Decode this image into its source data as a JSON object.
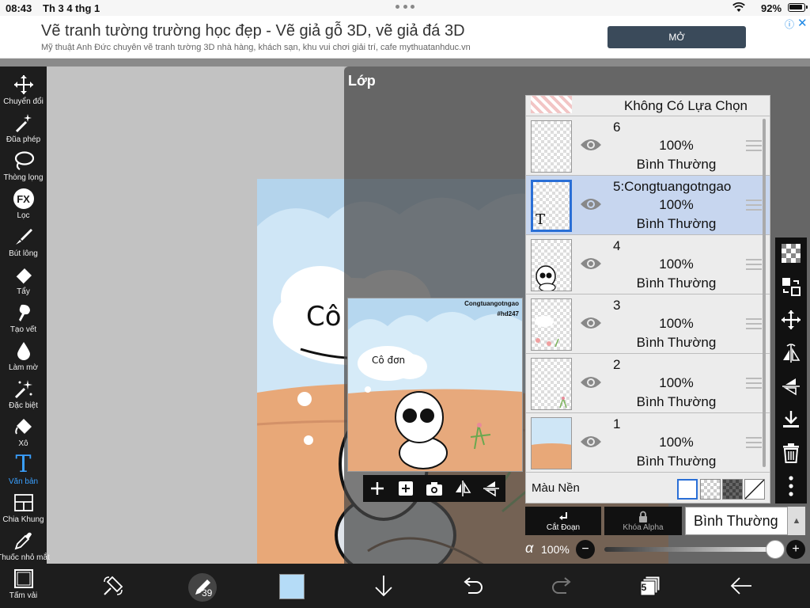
{
  "status_bar": {
    "time": "08:43",
    "date": "Th 3 4 thg 1",
    "battery": "92%"
  },
  "ad": {
    "title": "Vẽ tranh tường trường học đẹp - Vẽ giả gỗ 3D, vẽ giả đá 3D",
    "subtitle": "Mỹ thuật Anh Đức chuyên vẽ tranh tường 3D nhà hàng, khách sạn, khu vui chơi giải trí, cafe mythuatanhduc.vn",
    "button": "MỞ",
    "info_icon": "ⓘ",
    "close_icon": "✕"
  },
  "tools": [
    {
      "label": "Chuyển đổi",
      "icon": "move-icon"
    },
    {
      "label": "Đũa phép",
      "icon": "magic-wand-icon"
    },
    {
      "label": "Thòng lọng",
      "icon": "lasso-icon"
    },
    {
      "label": "Lọc",
      "icon": "fx-filter-icon",
      "glyph": "FX"
    },
    {
      "label": "Bút lông",
      "icon": "brush-icon"
    },
    {
      "label": "Tẩy",
      "icon": "eraser-icon"
    },
    {
      "label": "Tạo vết",
      "icon": "smudge-icon"
    },
    {
      "label": "Làm mờ",
      "icon": "blur-drop-icon"
    },
    {
      "label": "Đặc biệt",
      "icon": "special-sparkle-icon"
    },
    {
      "label": "Xô",
      "icon": "bucket-icon"
    },
    {
      "label": "Văn bản",
      "icon": "text-tool-icon",
      "glyph": "T",
      "active": true
    },
    {
      "label": "Chia Khung",
      "icon": "frame-divider-icon"
    },
    {
      "label": "Thuốc nhỏ mắt",
      "icon": "eyedropper-icon"
    },
    {
      "label": "Tấm vải",
      "icon": "canvas-icon"
    }
  ],
  "layer_panel": {
    "title": "Lớp",
    "no_selection": "Không Có Lựa Chọn",
    "layers": [
      {
        "name": "6",
        "opacity": "100%",
        "blend": "Bình Thường",
        "selected": false
      },
      {
        "name": "5:Congtuangotngao",
        "opacity": "100%",
        "blend": "Bình Thường",
        "selected": true,
        "thumb_glyph": "T"
      },
      {
        "name": "4",
        "opacity": "100%",
        "blend": "Bình Thường",
        "selected": false
      },
      {
        "name": "3",
        "opacity": "100%",
        "blend": "Bình Thường",
        "selected": false
      },
      {
        "name": "2",
        "opacity": "100%",
        "blend": "Bình Thường",
        "selected": false
      },
      {
        "name": "1",
        "opacity": "100%",
        "blend": "Bình Thường",
        "selected": false
      }
    ],
    "background_label": "Màu Nền",
    "clip_label": "Cắt Đoạn",
    "alpha_lock_label": "Khóa Alpha",
    "blend_mode": "Bình Thường",
    "alpha_symbol": "α",
    "opacity_value": "100%",
    "opacity_level": 1.0,
    "minus": "−",
    "plus": "+"
  },
  "preview": {
    "text_line1": "Congtuangotngao",
    "text_line2": "#hd247",
    "cloud_text": "Cô đơn"
  },
  "canvas_text": "Cô",
  "bottom_bar": {
    "brush_size": "39",
    "layer_count": "5",
    "color": "#b5dcf7"
  },
  "colors": {
    "accent": "#3aa0ff",
    "selected_layer": "#c7d6ef",
    "sky": "#cfe6f6",
    "ground": "#e8a878"
  }
}
